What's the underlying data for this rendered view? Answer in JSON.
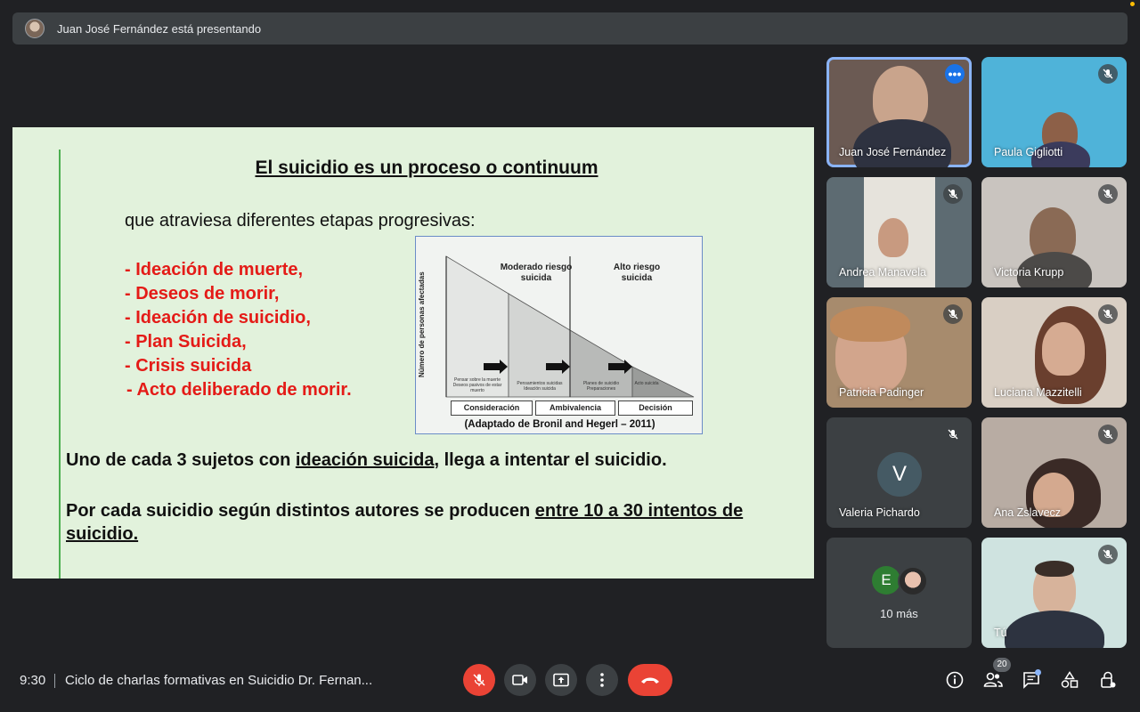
{
  "banner": {
    "presenter_text": "Juan José Fernández está presentando"
  },
  "slide": {
    "title": "El suicidio es un proceso o continuum",
    "subtitle": "que atraviesa diferentes etapas progresivas:",
    "items": [
      "- Ideación de muerte,",
      "- Deseos de morir,",
      "- Ideación de suicidio,",
      "- Plan Suicida,",
      "- Crisis suicida",
      "- Acto deliberado de morir."
    ],
    "p1_start": "Uno de cada 3 sujetos con ",
    "p1_underline": "ideación suicida",
    "p1_end": ", llega a intentar el suicidio.",
    "p2_start": "Por cada suicidio según distintos autores se producen ",
    "p2_underline": "entre 10 a 30 intentos de suicidio.",
    "diagram": {
      "y_label": "Número de personas afectadas",
      "header_moderate": "Moderado riesgo suicida",
      "header_high": "Alto riesgo suicida",
      "zone_texts": [
        "Pensar sobre la muerte Deseos pasivos de estar muerto",
        "Pensamientos suicidas Ideación suicida",
        "Planes de suicidio Preparaciones",
        "Acto suicida"
      ],
      "stages": [
        "Consideración",
        "Ambivalencia",
        "Decisión"
      ],
      "caption": "(Adaptado de Bronil and Hegerl – 2011)"
    }
  },
  "participants": [
    {
      "name": "Juan José Fernández",
      "state": "presenting"
    },
    {
      "name": "Paula Gigliotti",
      "state": "muted"
    },
    {
      "name": "Andrea Manavela",
      "state": "muted"
    },
    {
      "name": "Victoria Krupp",
      "state": "muted"
    },
    {
      "name": "Patricia Padinger",
      "state": "muted"
    },
    {
      "name": "Luciana Mazzitelli",
      "state": "muted"
    },
    {
      "name": "Valeria Pichardo",
      "initial": "V",
      "state": "muted"
    },
    {
      "name": "Ana Zslavecz",
      "state": "muted"
    },
    {
      "name": "Tú",
      "state": "muted"
    }
  ],
  "more_tile": {
    "initial": "E",
    "label": "10 más"
  },
  "bottom": {
    "time": "9:30",
    "meeting_title": "Ciclo de charlas formativas en Suicidio Dr. Fernan...",
    "people_count": "20"
  },
  "colors": {
    "slide_bg": "#e2f2dc",
    "list_red": "#e41b17",
    "end_call": "#ea4335",
    "accent": "#8ab4f8"
  }
}
